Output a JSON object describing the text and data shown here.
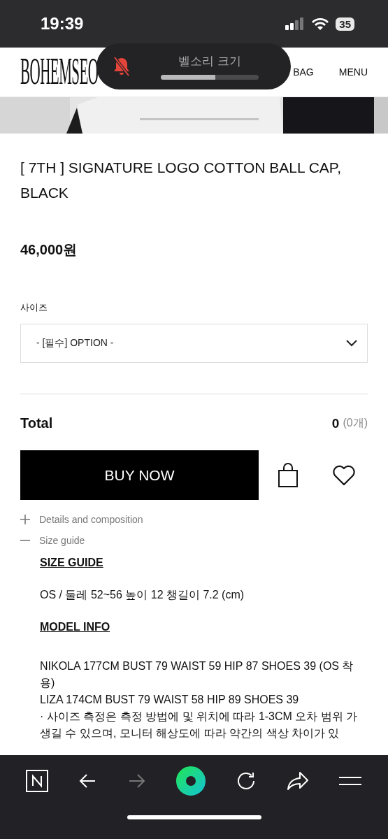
{
  "status_bar": {
    "time": "19:39",
    "battery": "35"
  },
  "volume_hud": {
    "title": "벨소리 크기",
    "muted": true,
    "level": 0.56
  },
  "header": {
    "logo": "BOHEMSEO",
    "nav": [
      "BAG",
      "MENU"
    ]
  },
  "product": {
    "title": "[ 7TH ] SIGNATURE LOGO COTTON BALL CAP, BLACK",
    "price": "46,000원"
  },
  "option": {
    "label": "사이즈",
    "placeholder": "- [필수] OPTION -"
  },
  "total": {
    "label": "Total",
    "amount": "0",
    "count": "(0개)"
  },
  "buy_button": "BUY NOW",
  "accordion": [
    {
      "label": "Details and composition",
      "expanded": false
    },
    {
      "label": "Size guide",
      "expanded": true
    }
  ],
  "size_guide": {
    "heading": "SIZE GUIDE",
    "size": "OS / 둘레 52~56 높이 12 챙길이 7.2 (cm)",
    "model_heading": "MODEL INFO",
    "models": [
      "NIKOLA 177CM BUST 79 WAIST 59 HIP 87 SHOES 39 (OS 착용)",
      "LIZA 174CM BUST 79 WAIST 58 HIP 89 SHOES 39"
    ],
    "note": "· 사이즈 측정은 측정 방법에 및 위치에 따라 1-3CM 오차 범위 가 생길 수 있으며, 모니터 해상도에 따라 약간의 색상 차이가 있"
  },
  "toolbar": [
    {
      "kind": "n"
    },
    {
      "kind": "back",
      "disabled": false
    },
    {
      "kind": "forward",
      "disabled": true
    },
    {
      "kind": "home"
    },
    {
      "kind": "reload"
    },
    {
      "kind": "share"
    },
    {
      "kind": "menu"
    }
  ]
}
